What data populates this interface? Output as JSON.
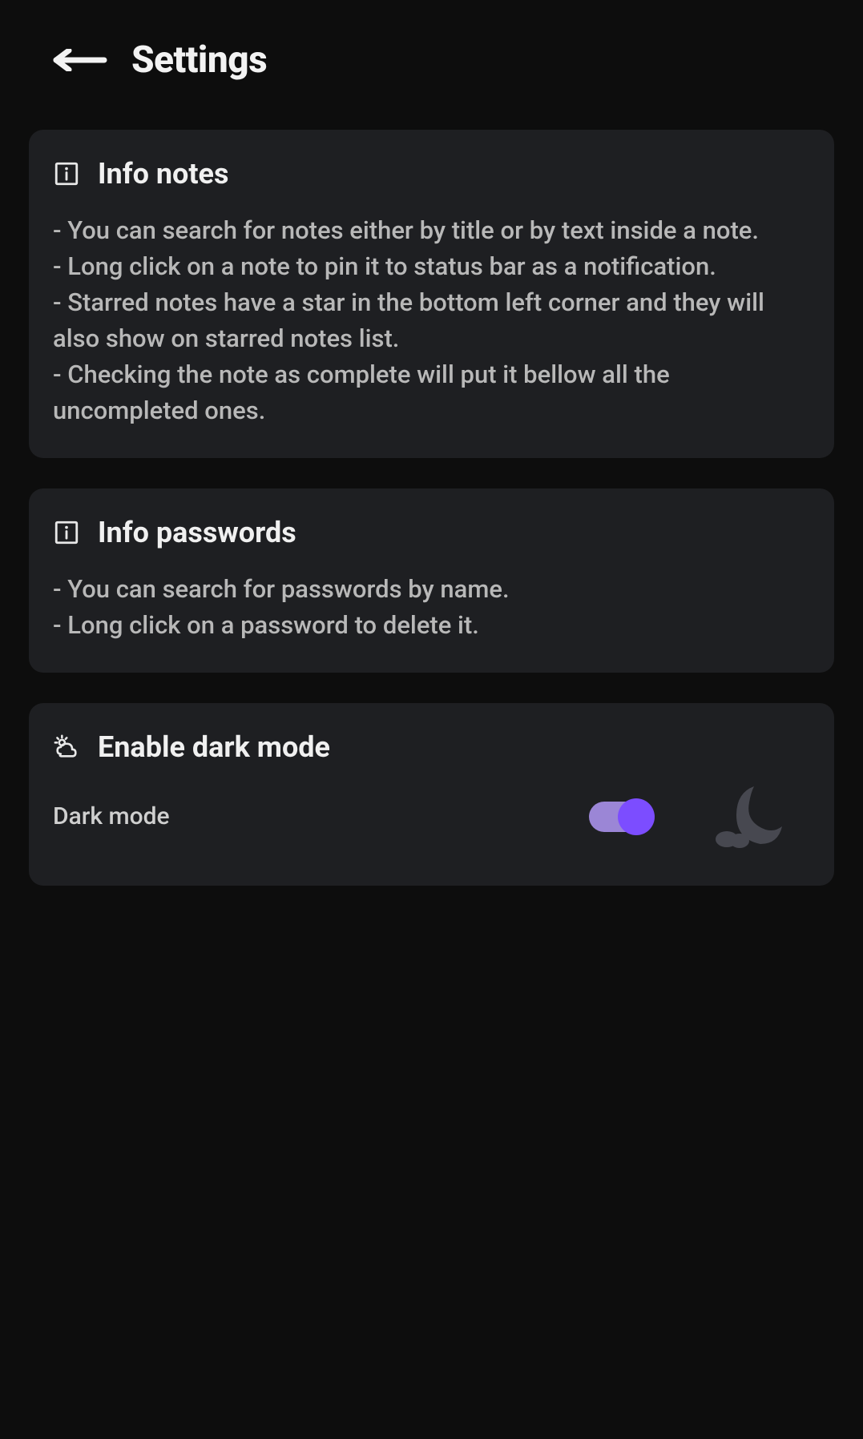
{
  "header": {
    "title": "Settings"
  },
  "cards": {
    "notes": {
      "title": "Info notes",
      "lines": [
        "- You can search for notes either by title or by text inside a note.",
        "- Long click on a note to pin it to status bar as a notification.",
        "- Starred notes have a star in the bottom left corner and they will also show on starred notes list.",
        "- Checking the note as complete will put it bellow all the uncompleted ones."
      ]
    },
    "passwords": {
      "title": "Info passwords",
      "lines": [
        "- You can search for passwords by name.",
        "- Long click on a password to delete it."
      ]
    },
    "darkmode": {
      "title": "Enable dark mode",
      "label": "Dark mode",
      "enabled": true
    }
  },
  "colors": {
    "accent": "#7c4dff",
    "accent_light": "#9b86d6",
    "card_bg": "#1e1f22",
    "page_bg": "#0d0d0d"
  }
}
